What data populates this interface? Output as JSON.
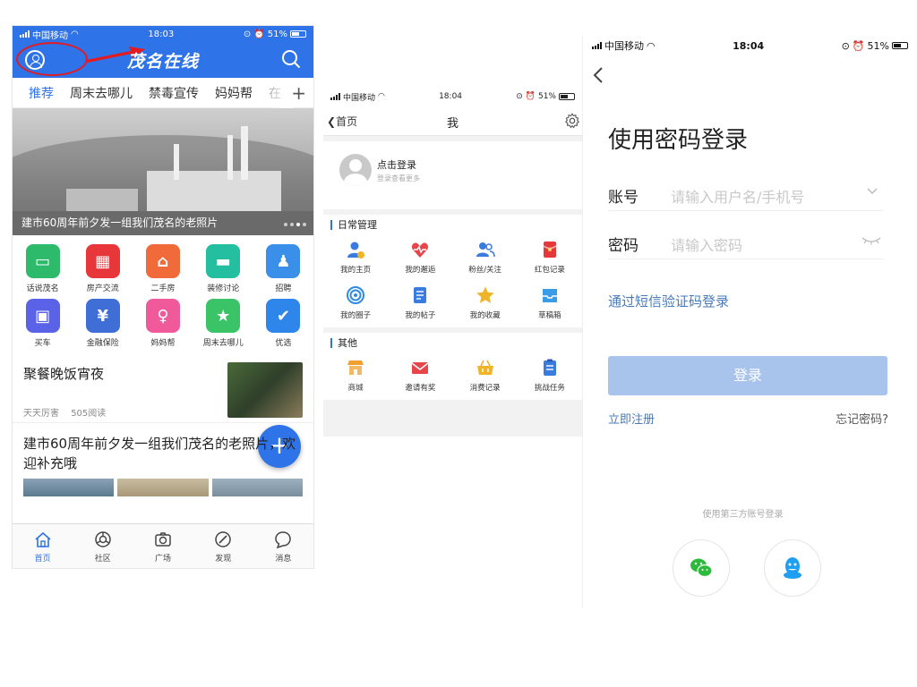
{
  "phone1": {
    "status": {
      "carrier": "中国移动",
      "time": "18:03",
      "battery": "51%"
    },
    "logo": "茂名在线",
    "tabs": [
      "推荐",
      "周末去哪儿",
      "禁毒宣传",
      "妈妈帮",
      "在"
    ],
    "banner_caption": "建市60周年前夕发一组我们茂名的老照片",
    "grid": [
      {
        "label": "话说茂名",
        "color": "#2dbb6b",
        "icon": "chat-icon"
      },
      {
        "label": "房产交流",
        "color": "#e8373b",
        "icon": "building-icon"
      },
      {
        "label": "二手房",
        "color": "#f06a3a",
        "icon": "house-icon"
      },
      {
        "label": "装修讨论",
        "color": "#24bfa0",
        "icon": "paint-roller-icon"
      },
      {
        "label": "招聘",
        "color": "#3a8fe8",
        "icon": "person-tie-icon"
      },
      {
        "label": "买车",
        "color": "#5a63e8",
        "icon": "car-icon"
      },
      {
        "label": "金融保险",
        "color": "#3f6fd6",
        "icon": "yuan-shield-icon"
      },
      {
        "label": "妈妈帮",
        "color": "#f05a9a",
        "icon": "mother-child-icon"
      },
      {
        "label": "周末去哪儿",
        "color": "#3ac467",
        "icon": "star-face-icon"
      },
      {
        "label": "优选",
        "color": "#2f86ea",
        "icon": "thumbs-up-icon"
      }
    ],
    "article1": {
      "title": "聚餐晚饭宵夜",
      "source": "天天厉害",
      "reads": "505阅读"
    },
    "article2": {
      "title": "建市60周年前夕发一组我们茂名的老照片，欢迎补充哦"
    },
    "fab": "+",
    "tabbar": [
      {
        "label": "首页",
        "icon": "home-icon",
        "active": true
      },
      {
        "label": "社区",
        "icon": "community-icon",
        "active": false
      },
      {
        "label": "广场",
        "icon": "camera-icon",
        "active": false
      },
      {
        "label": "发现",
        "icon": "compass-icon",
        "active": false
      },
      {
        "label": "消息",
        "icon": "message-icon",
        "active": false
      }
    ]
  },
  "phone2": {
    "status": {
      "carrier": "中国移动",
      "time": "18:04",
      "battery": "51%"
    },
    "back": "首页",
    "title": "我",
    "login_name": "点击登录",
    "login_sub": "登录查看更多",
    "section1": {
      "title": "日常管理",
      "items": [
        {
          "label": "我的主页",
          "icon": "user-home-icon",
          "color": "#3a7be0"
        },
        {
          "label": "我的邂逅",
          "icon": "heart-pulse-icon",
          "color": "#e8454a"
        },
        {
          "label": "粉丝/关注",
          "icon": "users-icon",
          "color": "#3a7be0"
        },
        {
          "label": "红包记录",
          "icon": "red-envelope-icon",
          "color": "#e8373b"
        },
        {
          "label": "我的圈子",
          "icon": "target-icon",
          "color": "#2f8ae6"
        },
        {
          "label": "我的帖子",
          "icon": "document-icon",
          "color": "#3a7be0"
        },
        {
          "label": "我的收藏",
          "icon": "star-icon",
          "color": "#f0b429"
        },
        {
          "label": "草稿箱",
          "icon": "inbox-icon",
          "color": "#3a9be8"
        }
      ]
    },
    "section2": {
      "title": "其他",
      "items": [
        {
          "label": "商城",
          "icon": "shop-icon",
          "color": "#f0a030"
        },
        {
          "label": "邀请有奖",
          "icon": "envelope-icon",
          "color": "#e8454a"
        },
        {
          "label": "消费记录",
          "icon": "basket-icon",
          "color": "#f0b429"
        },
        {
          "label": "挑战任务",
          "icon": "clipboard-icon",
          "color": "#3a7be0"
        }
      ]
    }
  },
  "phone3": {
    "status": {
      "carrier": "中国移动",
      "time": "18:04",
      "battery": "51%"
    },
    "heading": "使用密码登录",
    "account_label": "账号",
    "account_placeholder": "请输入用户名/手机号",
    "password_label": "密码",
    "password_placeholder": "请输入密码",
    "sms_link": "通过短信验证码登录",
    "login_button": "登录",
    "register": "立即注册",
    "forgot": "忘记密码?",
    "third_party": "使用第三方账号登录",
    "colors": {
      "link": "#4a7ab8",
      "button": "#a8c4ec"
    }
  }
}
